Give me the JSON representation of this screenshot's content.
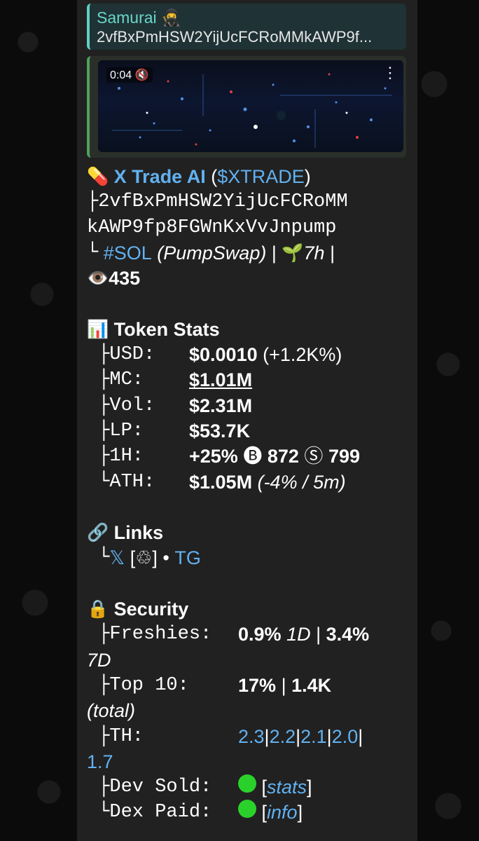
{
  "reply": {
    "name": "Samurai 🥷",
    "text": "2vfBxPmHSW2YijUcFCRoMMkAWP9f..."
  },
  "video": {
    "time": "0:04",
    "mute_icon": "mute-icon",
    "menu_icon": "more-vertical-icon"
  },
  "token": {
    "pill": "💊",
    "name": "X Trade AI",
    "open_paren": "(",
    "ticker": "$XTRADE",
    "close_paren": ")",
    "addr_prefix": "├",
    "addr_line1": "2vfBxPmHSW2YijUcFCRoMM",
    "addr_line2": "kAWP9fp8FGWnKxVvJnpump",
    "chain_prefix": "└",
    "chain": "#SOL",
    "dex": "(PumpSwap)",
    "sep1": "|",
    "age_icon": "🌱",
    "age": "7h",
    "sep2": "|",
    "eye_icon": "👁️",
    "views": "435"
  },
  "stats": {
    "icon": "📊",
    "title": "Token Stats",
    "usd": {
      "prefix": "├",
      "label": "USD:",
      "value": "$0.0010",
      "change": "(+1.2K%)"
    },
    "mc": {
      "prefix": "├",
      "label": "MC:",
      "value": "$1.01M"
    },
    "vol": {
      "prefix": "├",
      "label": "Vol:",
      "value": "$2.31M"
    },
    "lp": {
      "prefix": "├",
      "label": "LP:",
      "value": "$53.7K"
    },
    "h1": {
      "prefix": "├",
      "label": "1H:",
      "value": "+25%",
      "buy_icon": "🅑",
      "buys": "872",
      "sell_icon": "Ⓢ",
      "sells": "799"
    },
    "ath": {
      "prefix": "└",
      "label": "ATH:",
      "value": "$1.05M",
      "note": "(-4% / 5m)"
    }
  },
  "links": {
    "icon": "🔗",
    "title": "Links",
    "prefix": "└",
    "x": "𝕏",
    "x_extra": "[♲]",
    "dot": "•",
    "tg": "TG"
  },
  "security": {
    "icon": "🔒",
    "title": "Security",
    "freshies": {
      "prefix": "├",
      "label": "Freshies:",
      "v1": "0.9%",
      "p1": "1D",
      "sep": "|",
      "v2": "3.4%",
      "p2": "7D"
    },
    "top10": {
      "prefix": "├",
      "label": "Top 10:",
      "v1": "17%",
      "sep": "|",
      "v2": "1.4K",
      "note": "(total)"
    },
    "th": {
      "prefix": "├",
      "label": "TH:",
      "values": [
        "2.3",
        "2.2",
        "2.1",
        "2.0",
        "1.7"
      ],
      "sep": "|"
    },
    "dev_sold": {
      "prefix": "├",
      "label": "Dev Sold:",
      "status_color": "#2bd12b",
      "link": "stats"
    },
    "dex_paid": {
      "prefix": "└",
      "label": "Dex Paid:",
      "status_color": "#2bd12b",
      "link": "info"
    }
  }
}
